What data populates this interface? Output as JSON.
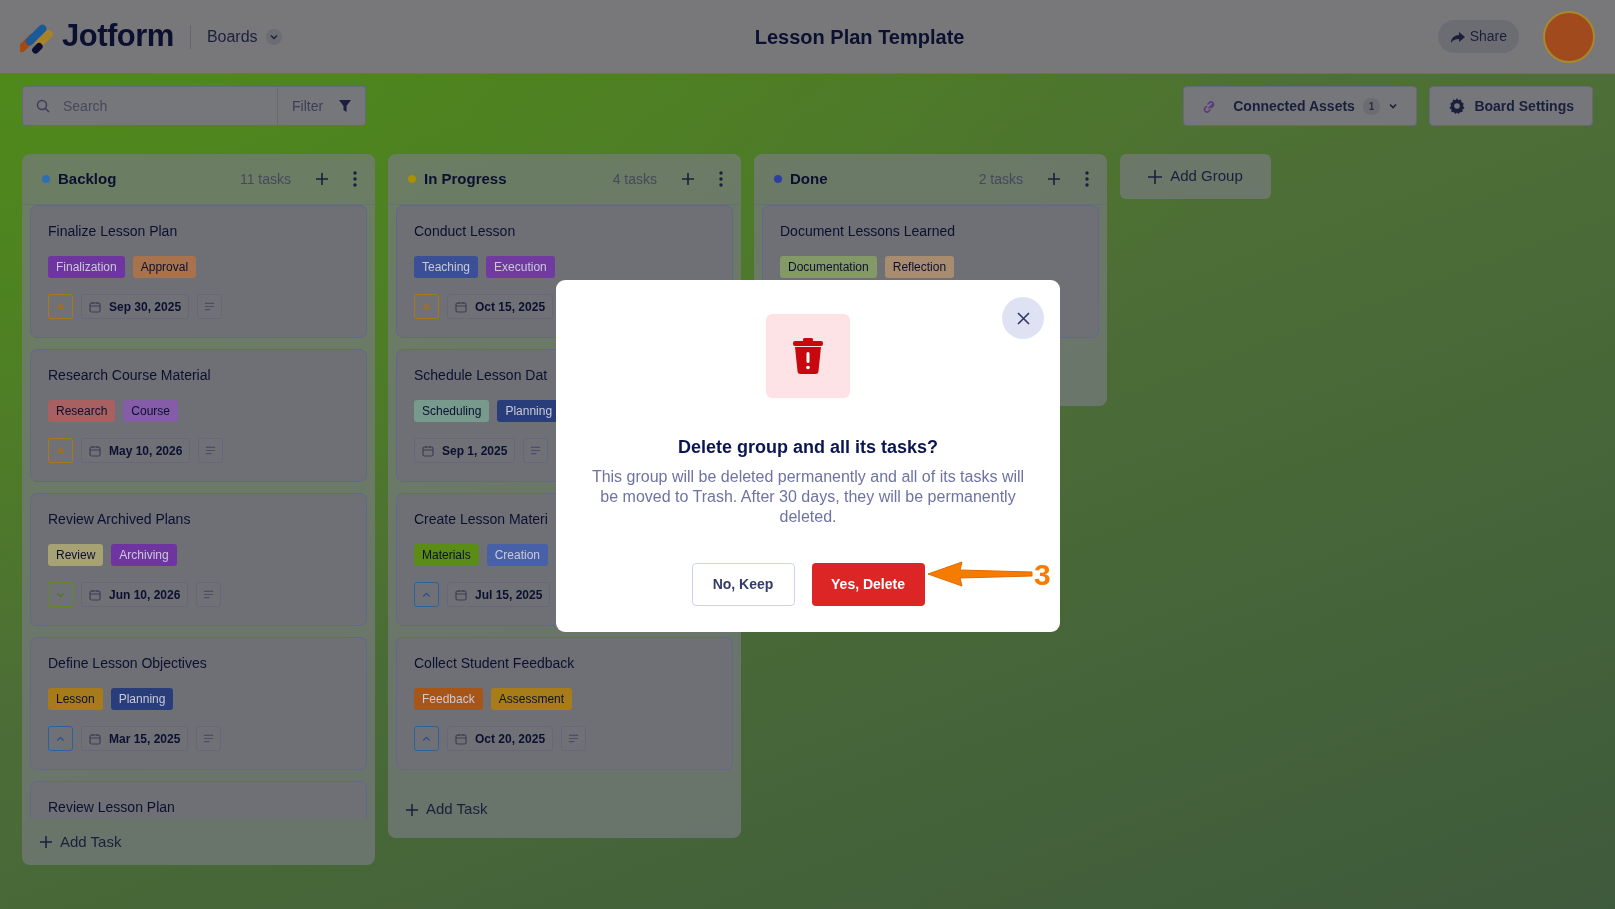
{
  "header": {
    "logo_text": "Jotform",
    "menu": "Boards",
    "title": "Lesson Plan Template",
    "share": "Share"
  },
  "toolbar": {
    "search_placeholder": "Search",
    "filter": "Filter",
    "connected_assets": {
      "label": "Connected Assets",
      "count": "1"
    },
    "board_settings": "Board Settings"
  },
  "groups": [
    {
      "name": "Backlog",
      "color": "#2f6db5",
      "count": "11 tasks",
      "add_task": "Add Task",
      "tasks": [
        {
          "title": "Finalize Lesson Plan",
          "tags": [
            {
              "label": "Finalization",
              "color": "#6e34a0"
            },
            {
              "label": "Approval",
              "color": "#a8724c"
            }
          ],
          "priority": {
            "kind": "high"
          },
          "date": "Sep 30, 2025",
          "notes": true
        },
        {
          "title": "Research Course Material",
          "tags": [
            {
              "label": "Research",
              "color": "#a86060"
            },
            {
              "label": "Course",
              "color": "#845ca8"
            }
          ],
          "priority": {
            "kind": "high"
          },
          "date": "May 10, 2026",
          "notes": true
        },
        {
          "title": "Review Archived Plans",
          "tags": [
            {
              "label": "Review",
              "color": "#a6a274"
            },
            {
              "label": "Archiving",
              "color": "#6e34a0"
            }
          ],
          "priority": {
            "kind": "low"
          },
          "date": "Jun 10, 2026",
          "notes": true
        },
        {
          "title": "Define Lesson Objectives",
          "tags": [
            {
              "label": "Lesson",
              "color": "#a77a1c"
            },
            {
              "label": "Planning",
              "color": "#283d7a"
            }
          ],
          "priority": {
            "kind": "medium"
          },
          "date": "Mar 15, 2025",
          "notes": true
        },
        {
          "title": "Review Lesson Plan"
        }
      ]
    },
    {
      "name": "In Progress",
      "color": "#a89000",
      "count": "4 tasks",
      "add_task": "Add Task",
      "tasks": [
        {
          "title": "Conduct Lesson",
          "tags": [
            {
              "label": "Teaching",
              "color": "#3a4f95"
            },
            {
              "label": "Execution",
              "color": "#713aa0"
            }
          ],
          "priority": {
            "kind": "high"
          },
          "date": "Oct 15, 2025"
        },
        {
          "title": "Schedule Lesson Dat",
          "tags": [
            {
              "label": "Scheduling",
              "color": "#789a8c"
            },
            {
              "label": "Planning",
              "color": "#283d7a"
            }
          ],
          "date": "Sep 1, 2025",
          "notes": true
        },
        {
          "title": "Create Lesson Materi",
          "tags": [
            {
              "label": "Materials",
              "color": "#5b8c16"
            },
            {
              "label": "Creation",
              "color": "#4760a8"
            }
          ],
          "priority": {
            "kind": "medium"
          },
          "date": "Jul 15, 2025"
        },
        {
          "title": "Collect Student Feedback",
          "tags": [
            {
              "label": "Feedback",
              "color": "#a85618"
            },
            {
              "label": "Assessment",
              "color": "#a87c18"
            }
          ],
          "priority": {
            "kind": "medium"
          },
          "date": "Oct 20, 2025",
          "notes": true
        }
      ]
    },
    {
      "name": "Done",
      "color": "#2f3ea0",
      "count": "2 tasks",
      "tasks": [
        {
          "title": "Document Lessons Learned",
          "tags": [
            {
              "label": "Documentation",
              "color": "#849a66"
            },
            {
              "label": "Reflection",
              "color": "#a88c70"
            }
          ]
        }
      ]
    }
  ],
  "add_group": "Add Group",
  "dialog": {
    "title": "Delete group and all its tasks?",
    "message": "This group will be deleted permanently and all of its tasks will be moved to Trash. After 30 days, they will be permanently deleted.",
    "buttons": [
      {
        "label": "No, Keep",
        "kind": "secondary"
      },
      {
        "label": "Yes, Delete",
        "kind": "danger"
      }
    ]
  },
  "annotation": {
    "label": "3"
  }
}
